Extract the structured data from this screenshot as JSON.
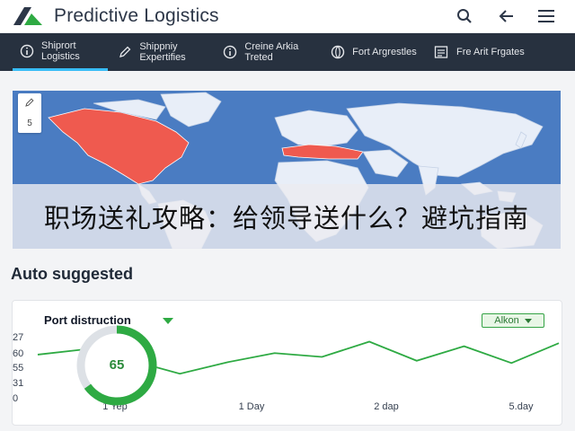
{
  "app": {
    "title": "Predictive Logistics"
  },
  "header_icons": [
    "search-icon",
    "back-arrow-icon",
    "menu-icon"
  ],
  "nav": {
    "tabs": [
      {
        "label": "Shiprort Logistics",
        "icon": "info-circle-icon",
        "active": true
      },
      {
        "label": "Shippniy Expertifies",
        "icon": "pencil-icon",
        "active": false
      },
      {
        "label": "Creine Arkia Treted",
        "icon": "info-circle-icon",
        "active": false
      },
      {
        "label": "Fort Argrestles",
        "icon": "globe-icon",
        "active": false
      },
      {
        "label": "Fre Arit Frgates",
        "icon": "image-list-icon",
        "active": false
      }
    ]
  },
  "map": {
    "tools": [
      {
        "icon": "pencil-icon"
      },
      {
        "label": "5"
      }
    ]
  },
  "overlay": {
    "text": "职场送礼攻略：给领导送什么？避坑指南"
  },
  "section": {
    "title": "Auto suggested"
  },
  "card": {
    "title": "Port distruction",
    "filter_label": "Alkon",
    "gauge": {
      "value": "65",
      "fraction": 0.65
    }
  },
  "colors": {
    "accent_green": "#2eaa43",
    "map_blue": "#4a7cc2",
    "highlight_red": "#ef5a4f",
    "nav_bg": "#27313f",
    "active_tab": "#38bdf8"
  },
  "chart_data": {
    "type": "line",
    "yticks": [
      "27",
      "60",
      "55",
      "31",
      "0"
    ],
    "xticks": [
      "1 Yep",
      "1 Day",
      "2 dap",
      "5.day"
    ],
    "series": [
      {
        "values": [
          53,
          60,
          45,
          28,
          43,
          55,
          50,
          70,
          45,
          64,
          42,
          68
        ]
      }
    ],
    "ylim": [
      0,
      80
    ]
  }
}
